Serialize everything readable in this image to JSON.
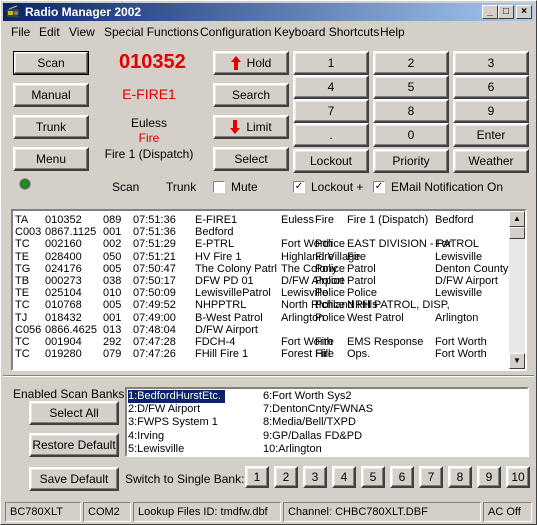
{
  "window": {
    "title": "Radio Manager 2002"
  },
  "menu": [
    "File",
    "Edit",
    "View",
    "Special Functions",
    "Configuration",
    "Keyboard Shortcuts",
    "Help"
  ],
  "left_buttons": {
    "scan": "Scan",
    "manual": "Manual",
    "trunk": "Trunk",
    "menu": "Menu"
  },
  "display": {
    "id": "010352",
    "tag": "E-FIRE1",
    "location": "Euless",
    "service": "Fire",
    "desc": "Fire 1 (Dispatch)"
  },
  "mode_labels": {
    "scan": "Scan",
    "trunk": "Trunk"
  },
  "center_buttons": {
    "hold": "Hold",
    "search": "Search",
    "limit": "Limit",
    "select": "Select"
  },
  "keypad": [
    "1",
    "2",
    "3",
    "4",
    "5",
    "6",
    "7",
    "8",
    "9",
    ".",
    "0",
    "Enter"
  ],
  "func_buttons": {
    "lockout": "Lockout",
    "priority": "Priority",
    "weather": "Weather"
  },
  "checks": {
    "mute": "Mute",
    "lockout_plus": "Lockout +",
    "email": "EMail Notification On"
  },
  "check_state": {
    "mute": false,
    "lockout_plus": true,
    "email": true
  },
  "log": [
    [
      "TA",
      "010352",
      "089",
      "07:51:36",
      "E-FIRE1",
      "Euless",
      "Fire",
      "Fire 1 (Dispatch)",
      "Bedford"
    ],
    [
      "C003",
      "0867.1125",
      "001",
      "07:51:36",
      "Bedford",
      "",
      "",
      "",
      ""
    ],
    [
      "TC",
      "002160",
      "002",
      "07:51:29",
      "E-PTRL",
      "Fort Worth",
      "Police",
      "EAST DIVISION - PATROL",
      "For"
    ],
    [
      "TE",
      "028400",
      "050",
      "07:51:21",
      "HV Fire 1",
      "Highland Village",
      "Fire",
      "Fire",
      "Lewisville"
    ],
    [
      "TG",
      "024176",
      "005",
      "07:50:47",
      "The Colony Patrl",
      "The Colony",
      "Police",
      "Patrol",
      "Denton County"
    ],
    [
      "TB",
      "000273",
      "038",
      "07:50:17",
      "DFW PD 01",
      "D/FW Airport",
      "Police",
      "Patrol",
      "D/FW Airport"
    ],
    [
      "TE",
      "025104",
      "010",
      "07:50:09",
      "LewisvillePatrol",
      "Lewisville",
      "Police",
      "Police",
      "Lewisville"
    ],
    [
      "TC",
      "010768",
      "005",
      "07:49:52",
      "NHPPTRL",
      "North Richland Hills",
      "Police",
      "NRH PATROL, DISP,",
      ""
    ],
    [
      "TJ",
      "018432",
      "001",
      "07:49:00",
      "B-West Patrol",
      "Arlington",
      "Police",
      "West Patrol",
      "Arlington"
    ],
    [
      "C056",
      "0866.4625",
      "013",
      "07:48:04",
      "D/FW Airport",
      "",
      "",
      "",
      ""
    ],
    [
      "TC",
      "001904",
      "292",
      "07:47:28",
      "FDCH-4",
      "Fort Worth",
      "Fire",
      "EMS Response",
      "Fort Worth"
    ],
    [
      "TC",
      "019280",
      "079",
      "07:47:26",
      "FHill Fire 1",
      "Forest Hill",
      "Fire",
      "Ops.",
      "Fort Worth"
    ]
  ],
  "banks_section": {
    "label": "Enabled Scan Banks",
    "select_all": "Select All",
    "restore_default": "Restore Default",
    "save_default": "Save Default",
    "switch_label": "Switch to Single Bank:",
    "single": [
      "1",
      "2",
      "3",
      "4",
      "5",
      "6",
      "7",
      "8",
      "9",
      "10"
    ],
    "banks": [
      "1:BedfordHurstEtc.",
      "2:D/FW Airport",
      "3:FWPS System 1",
      "4:Irving",
      "5:Lewisville",
      "6:Fort Worth Sys2",
      "7:DentonCnty/FWNAS",
      "8:Media/Bell/TXPD",
      "9:GP/Dallas FD&PD",
      "10:Arlington"
    ]
  },
  "status": {
    "model": "BC780XLT",
    "port": "COM2",
    "lookup": "Lookup Files ID: tmdfw.dbf",
    "channel": "Channel: CHBC780XLT.DBF",
    "ac": "AC Off"
  },
  "colors": {
    "title_start": "#0a246a",
    "title_end": "#a6caf0",
    "accent_red": "#e00000",
    "face": "#d4d0c8",
    "selection": "#0a246a"
  }
}
